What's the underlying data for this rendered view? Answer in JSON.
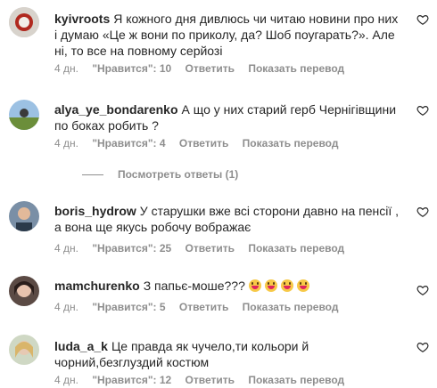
{
  "colors": {
    "text": "#262626",
    "secondary": "#8e8e8e"
  },
  "comments": [
    {
      "username": "kyivroots",
      "text": "Я кожного дня дивлюсь чи читаю новини про них і думаю «Це ж вони по приколу, да? Шоб поугарать?». Але ні, то все на повному серйозі",
      "age": "4 дн.",
      "likes": "\"Нравится\": 10",
      "reply": "Ответить",
      "translate": "Показать перевод",
      "avatar_icon": "avatar-icon"
    },
    {
      "username": "alya_ye_bondarenko",
      "text": "А що у них старий герб Чернігівщини по боках робить ?",
      "age": "4 дн.",
      "likes": "\"Нравится\": 4",
      "reply": "Ответить",
      "translate": "Показать перевод",
      "avatar_icon": "avatar-icon"
    },
    {
      "username": "boris_hydrow",
      "text": "У старушки вже всі сторони давно на пенсії , а вона ще якусь робочу вображає",
      "age": "4 дн.",
      "likes": "\"Нравится\": 25",
      "reply": "Ответить",
      "translate": "Показать перевод",
      "avatar_icon": "avatar-icon"
    },
    {
      "username": "mamchurenko",
      "text": "З папьє-моше???",
      "age": "4 дн.",
      "likes": "\"Нравится\": 5",
      "reply": "Ответить",
      "translate": "Показать перевод",
      "avatar_icon": "avatar-icon",
      "emoji_count": 4
    },
    {
      "username": "luda_a_k",
      "text": "Це правда як чучело,ти кольори й чорний,безглуздий костюм",
      "age": "4 дн.",
      "likes": "\"Нравится\": 12",
      "reply": "Ответить",
      "translate": "Показать перевод",
      "avatar_icon": "avatar-icon"
    }
  ],
  "view_replies": "Посмотреть ответы (1)"
}
